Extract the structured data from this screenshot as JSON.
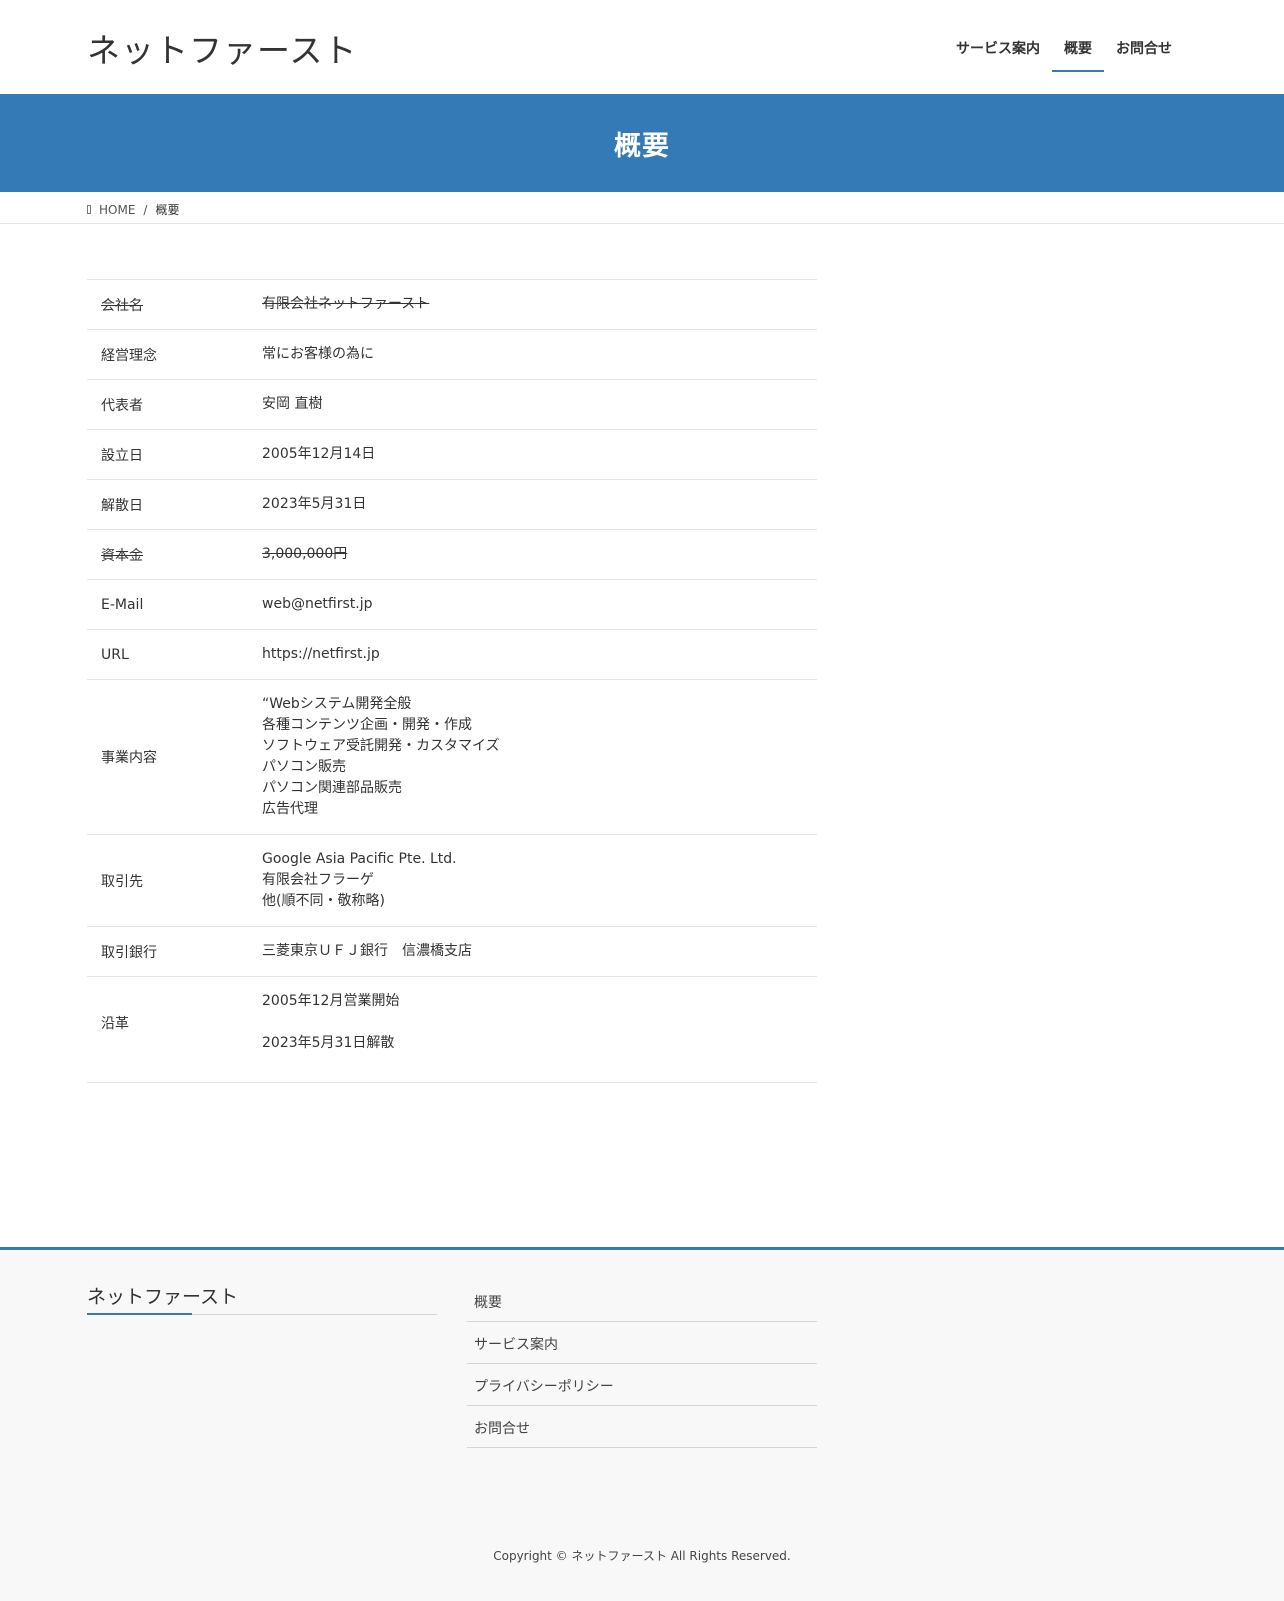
{
  "header": {
    "logo": "ネットファースト",
    "nav": [
      {
        "label": "サービス案内",
        "active": false
      },
      {
        "label": "概要",
        "active": true
      },
      {
        "label": "お問合せ",
        "active": false
      }
    ]
  },
  "page_title": "概要",
  "breadcrumb": {
    "home": "HOME",
    "separator": "/",
    "current": "概要"
  },
  "company": {
    "name_label": "会社名",
    "name_value": "有限会社ネットファースト",
    "philosophy_label": "経営理念",
    "philosophy_value": "常にお客様の為に",
    "representative_label": "代表者",
    "representative_value": "安岡 直樹",
    "founded_label": "設立日",
    "founded_value": "2005年12月14日",
    "dissolved_label": "解散日",
    "dissolved_value": "2023年5月31日",
    "capital_label": "資本金",
    "capital_value": "3,000,000円",
    "email_label": "E-Mail",
    "email_value": "web@netfirst.jp",
    "url_label": "URL",
    "url_value": "https://netfirst.jp",
    "business_label": "事業内容",
    "business_lines": [
      "“Webシステム開発全般",
      "各種コンテンツ企画・開発・作成",
      "ソフトウェア受託開発・カスタマイズ",
      "パソコン販売",
      "パソコン関連部品販売",
      "広告代理"
    ],
    "clients_label": "取引先",
    "clients_lines": [
      "Google Asia Pacific Pte. Ltd.",
      "有限会社フラーゲ",
      "他(順不同・敬称略)"
    ],
    "bank_label": "取引銀行",
    "bank_value": "三菱東京ＵＦＪ銀行　信濃橋支店",
    "history_label": "沿革",
    "history_lines": [
      "2005年12月営業開始",
      "2023年5月31日解散"
    ]
  },
  "footer": {
    "logo": "ネットファースト",
    "menu": [
      "概要",
      "サービス案内",
      "プライバシーポリシー",
      "お問合せ"
    ],
    "copyright": "Copyright © ネットファースト All Rights Reserved."
  },
  "colors": {
    "accent": "#337ab7",
    "footer_bg": "#f8f8f8"
  }
}
